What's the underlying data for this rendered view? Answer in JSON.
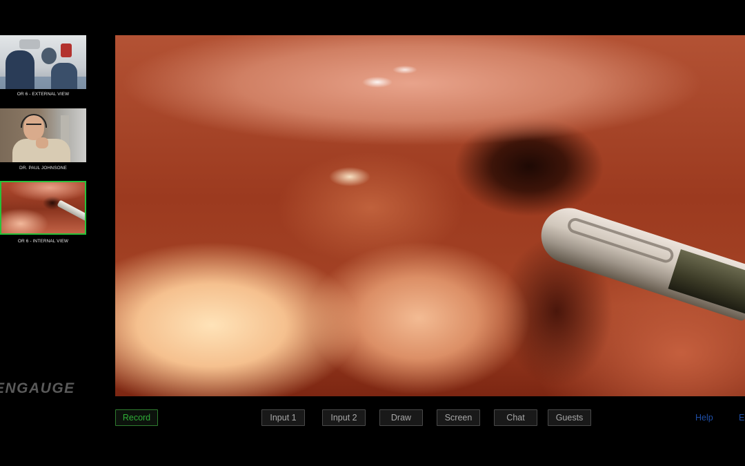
{
  "thumbnails": [
    {
      "label": "OR 6 - EXTERNAL VIEW"
    },
    {
      "label": "DR. PAUL JOHNSONE"
    },
    {
      "label": "OR 6 - INTERNAL VIEW"
    }
  ],
  "logo": {
    "text": "ENGAUGE"
  },
  "toolbar": {
    "record_label": "Record",
    "input1_label": "Input 1",
    "input2_label": "Input 2",
    "draw_label": "Draw",
    "screen_label": "Screen",
    "chat_label": "Chat",
    "guests_label": "Guests"
  },
  "links": {
    "help_label": "Help",
    "exit_label": "E"
  },
  "colors": {
    "active_border": "#27c23a",
    "record_text": "#2fae37",
    "link_text": "#1f4fa8",
    "background": "#000000"
  }
}
